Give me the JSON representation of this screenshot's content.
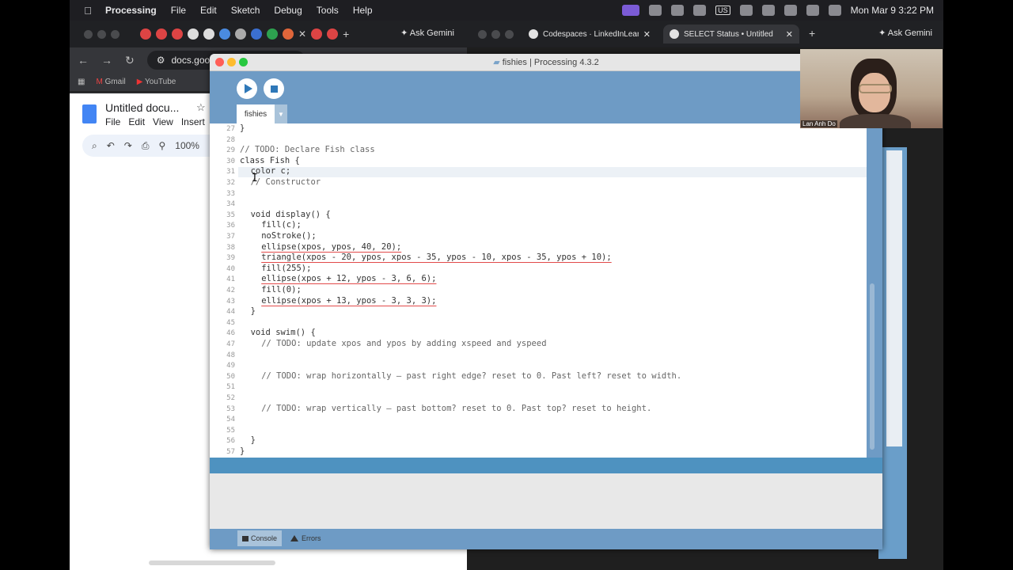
{
  "menubar": {
    "app": "Processing",
    "items": [
      "File",
      "Edit",
      "Sketch",
      "Debug",
      "Tools",
      "Help"
    ],
    "keyboard": "US",
    "clock": "Mon Mar 9  3:22 PM"
  },
  "chrome_left": {
    "ask_gemini": "Ask Gemini",
    "address": "docs.google",
    "bookmarks": [
      "Gmail",
      "YouTube"
    ],
    "doc_title": "Untitled docu...",
    "doc_menu": [
      "File",
      "Edit",
      "View",
      "Insert"
    ],
    "zoom": "100%"
  },
  "chrome_right": {
    "tab1": "Codespaces · LinkedInLearni",
    "tab2": "SELECT Status • Untitled",
    "ask_gemini": "Ask Gemini"
  },
  "processing": {
    "window_title": "fishies | Processing 4.3.2",
    "sketch_tab": "fishies",
    "console_tab": "Console",
    "errors_tab": "Errors",
    "lines": [
      {
        "n": "27",
        "text": "}",
        "indent": 0,
        "kind": "normal"
      },
      {
        "n": "28",
        "text": "",
        "indent": 0,
        "kind": "normal"
      },
      {
        "n": "29",
        "text": "// TODO: Declare Fish class",
        "indent": 0,
        "kind": "comment"
      },
      {
        "n": "30",
        "text": "class Fish {",
        "indent": 0,
        "kind": "normal"
      },
      {
        "n": "31",
        "text": "color c;",
        "indent": 2,
        "kind": "normal"
      },
      {
        "n": "32",
        "text": "// Constructor",
        "indent": 2,
        "kind": "comment"
      },
      {
        "n": "33",
        "text": "",
        "indent": 0,
        "kind": "normal"
      },
      {
        "n": "34",
        "text": "",
        "indent": 0,
        "kind": "normal"
      },
      {
        "n": "35",
        "text": "void display() {",
        "indent": 2,
        "kind": "normal"
      },
      {
        "n": "36",
        "text": "fill(c);",
        "indent": 4,
        "kind": "normal"
      },
      {
        "n": "37",
        "text": "noStroke();",
        "indent": 4,
        "kind": "normal"
      },
      {
        "n": "38",
        "text": "ellipse(xpos, ypos, 40, 20);",
        "indent": 4,
        "kind": "err"
      },
      {
        "n": "39",
        "text": "triangle(xpos - 20, ypos, xpos - 35, ypos - 10, xpos - 35, ypos + 10);",
        "indent": 4,
        "kind": "err"
      },
      {
        "n": "40",
        "text": "fill(255);",
        "indent": 4,
        "kind": "normal"
      },
      {
        "n": "41",
        "text": "ellipse(xpos + 12, ypos - 3, 6, 6);",
        "indent": 4,
        "kind": "err"
      },
      {
        "n": "42",
        "text": "fill(0);",
        "indent": 4,
        "kind": "normal"
      },
      {
        "n": "43",
        "text": "ellipse(xpos + 13, ypos - 3, 3, 3);",
        "indent": 4,
        "kind": "err"
      },
      {
        "n": "44",
        "text": "}",
        "indent": 2,
        "kind": "normal"
      },
      {
        "n": "45",
        "text": "",
        "indent": 0,
        "kind": "normal"
      },
      {
        "n": "46",
        "text": "void swim() {",
        "indent": 2,
        "kind": "normal"
      },
      {
        "n": "47",
        "text": "// TODO: update xpos and ypos by adding xspeed and yspeed",
        "indent": 4,
        "kind": "comment"
      },
      {
        "n": "48",
        "text": "",
        "indent": 0,
        "kind": "normal"
      },
      {
        "n": "49",
        "text": "",
        "indent": 0,
        "kind": "normal"
      },
      {
        "n": "50",
        "text": "// TODO: wrap horizontally — past right edge? reset to 0. Past left? reset to width.",
        "indent": 4,
        "kind": "comment"
      },
      {
        "n": "51",
        "text": "",
        "indent": 0,
        "kind": "normal"
      },
      {
        "n": "52",
        "text": "",
        "indent": 0,
        "kind": "normal"
      },
      {
        "n": "53",
        "text": "// TODO: wrap vertically — past bottom? reset to 0. Past top? reset to height.",
        "indent": 4,
        "kind": "comment"
      },
      {
        "n": "54",
        "text": "",
        "indent": 0,
        "kind": "normal"
      },
      {
        "n": "55",
        "text": "",
        "indent": 0,
        "kind": "normal"
      },
      {
        "n": "56",
        "text": "}",
        "indent": 2,
        "kind": "normal"
      },
      {
        "n": "57",
        "text": "}",
        "indent": 0,
        "kind": "normal"
      }
    ],
    "highlighted_line": "31"
  },
  "webcam": {
    "name": "Lan Anh Do"
  },
  "colors": {
    "processing_blue": "#6e9bc5",
    "button_blue": "#2f78b8",
    "error_underline": "#e24a4a"
  }
}
